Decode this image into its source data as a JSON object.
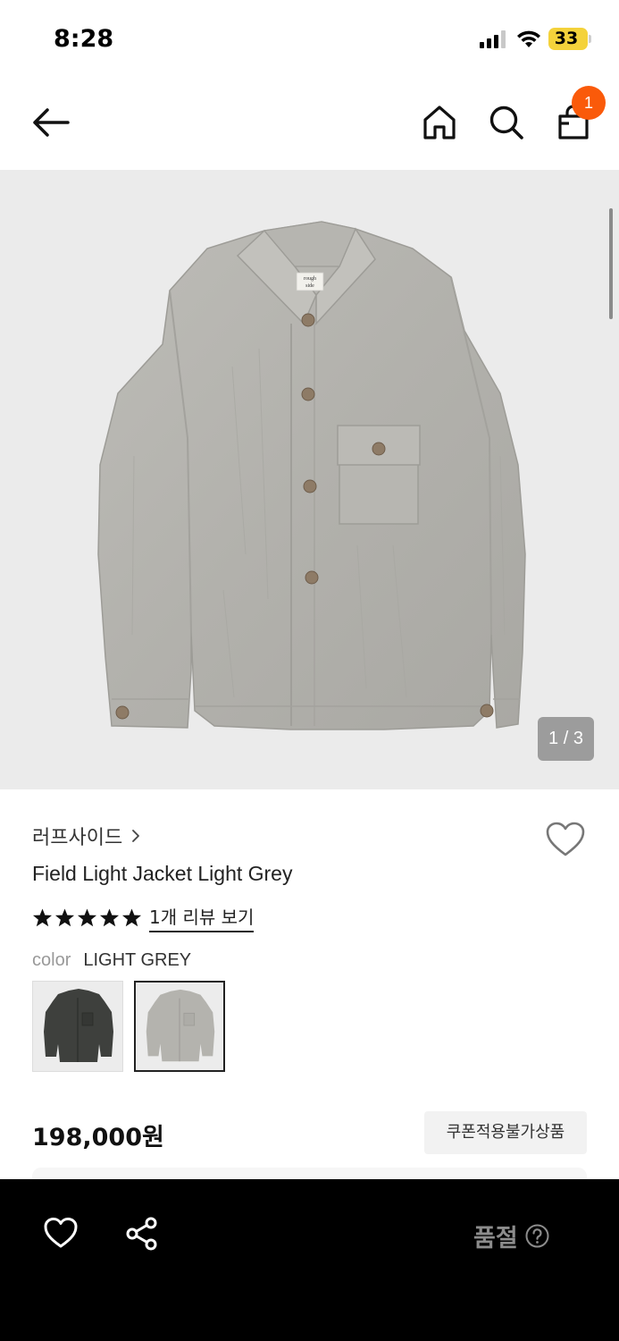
{
  "status_bar": {
    "time": "8:28",
    "battery": "33"
  },
  "nav": {
    "cart_count": "1",
    "icons": [
      "back-arrow-icon",
      "home-icon",
      "search-icon",
      "shopping-bag-icon"
    ]
  },
  "gallery": {
    "counter": "1 / 3",
    "label_text": "rough side"
  },
  "product": {
    "brand": "러프사이드",
    "name": "Field Light Jacket Light Grey",
    "rating_stars": 5,
    "review_link": "1개 리뷰 보기",
    "color_label": "color",
    "color_value": "LIGHT GREY",
    "price": "198,000원",
    "coupon_badge": "쿠폰적용불가상품"
  },
  "bottom_bar": {
    "status": "품절",
    "icons": [
      "heart-icon",
      "share-icon",
      "help-icon"
    ]
  },
  "colors": {
    "accent": "#fa5a0a",
    "jacket_grey": "#b3b2ad",
    "jacket_dark": "#3e403d",
    "bottom_bar": "#000000",
    "sold_out_text": "#8c8c8c"
  }
}
